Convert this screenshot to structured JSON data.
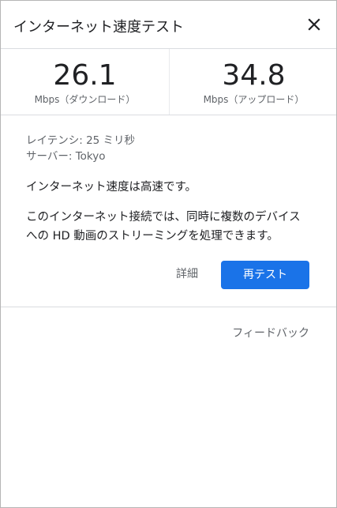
{
  "header": {
    "title": "インターネット速度テスト",
    "close_icon": "close-icon"
  },
  "speeds": {
    "download": {
      "value": "26.1",
      "unit_label": "Mbps（ダウンロード）"
    },
    "upload": {
      "value": "34.8",
      "unit_label": "Mbps（アップロード）"
    }
  },
  "details": {
    "latency": "レイテンシ: 25 ミリ秒",
    "server": "サーバー: Tokyo"
  },
  "result": {
    "status": "インターネット速度は高速です。",
    "description_lines": [
      "このインターネット接続では、同時に複数のデバイス",
      "への HD 動画のストリーミングを処理できます。"
    ]
  },
  "actions": {
    "details_label": "詳細",
    "retest_label": "再テスト"
  },
  "footer": {
    "feedback_label": "フィードバック"
  },
  "colors": {
    "accent": "#1a73e8",
    "text_primary": "#202124",
    "text_secondary": "#5f6368",
    "divider": "#dadce0"
  }
}
